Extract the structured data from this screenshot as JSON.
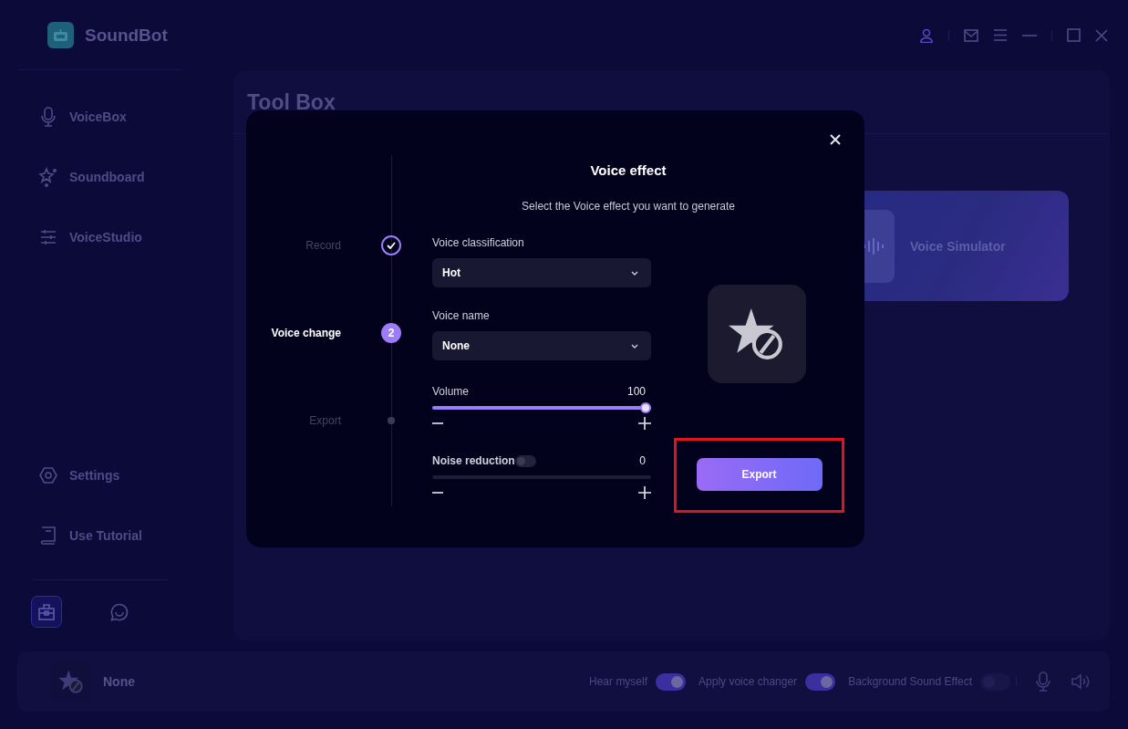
{
  "app": {
    "name": "SoundBot"
  },
  "sidebar": {
    "items": [
      {
        "label": "VoiceBox",
        "selected": false
      },
      {
        "label": "Soundboard",
        "selected": false
      },
      {
        "label": "VoiceStudio",
        "selected": false
      }
    ],
    "footer_items": [
      {
        "label": "Settings",
        "selected": false
      },
      {
        "label": "Use Tutorial",
        "selected": false
      }
    ],
    "shortcuts": [
      {
        "kind": "toolbox",
        "selected": true
      },
      {
        "kind": "chat",
        "selected": false
      }
    ]
  },
  "main": {
    "title": "Tool Box",
    "cards": [
      {
        "title": "Voice Simulator"
      }
    ]
  },
  "dialog": {
    "title": "Voice effect",
    "subtitle": "Select the Voice effect you want to generate",
    "steps": [
      {
        "label": "Record",
        "done": true,
        "active": false
      },
      {
        "label": "Voice change",
        "done": false,
        "active": true,
        "number": "2"
      },
      {
        "label": "Export",
        "done": false,
        "active": false
      }
    ],
    "fields": [
      {
        "label": "Voice classification",
        "value": "Hot"
      },
      {
        "label": "Voice name",
        "value": "None"
      }
    ],
    "sliders": [
      {
        "label": "Volume",
        "reading": "100",
        "level": 1,
        "disabled": false
      },
      {
        "label": "Noise reduction",
        "reading": "0",
        "level": 0,
        "disabled": true,
        "switch_on": false
      }
    ],
    "export_button": "Export"
  },
  "player": {
    "voice": "None",
    "toggles": [
      {
        "label": "Hear myself",
        "on": true
      },
      {
        "label": "Apply voice changer",
        "on": true
      },
      {
        "label": "Background Sound Effect",
        "on": false
      }
    ]
  }
}
